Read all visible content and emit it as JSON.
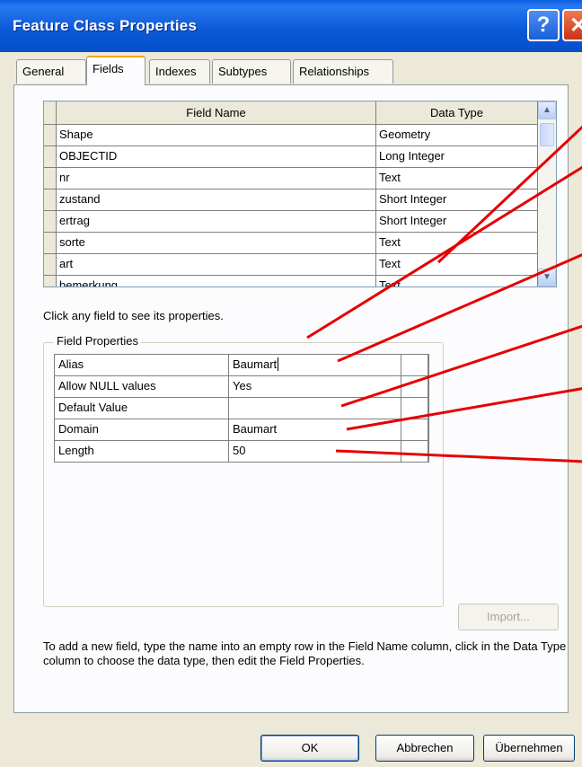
{
  "window": {
    "title": "Feature Class Properties",
    "help_glyph": "?",
    "close_glyph": "✕"
  },
  "tabs": [
    "General",
    "Fields",
    "Indexes",
    "Subtypes",
    "Relationships"
  ],
  "active_tab": "Fields",
  "fields_table": {
    "headers": [
      "Field Name",
      "Data Type"
    ],
    "rows": [
      [
        "Shape",
        "Geometry"
      ],
      [
        "OBJECTID",
        "Long Integer"
      ],
      [
        "nr",
        "Text"
      ],
      [
        "zustand",
        "Short Integer"
      ],
      [
        "ertrag",
        "Short Integer"
      ],
      [
        "sorte",
        "Text"
      ],
      [
        "art",
        "Text"
      ],
      [
        "bemerkung",
        "Text"
      ]
    ],
    "scroll_up_glyph": "▲",
    "scroll_down_glyph": "▼"
  },
  "hint_text": "Click any field to see its properties.",
  "field_properties": {
    "legend": "Field Properties",
    "rows": [
      [
        "Alias",
        "Baumart"
      ],
      [
        "Allow NULL values",
        "Yes"
      ],
      [
        "Default Value",
        ""
      ],
      [
        "Domain",
        "Baumart"
      ],
      [
        "Length",
        "50"
      ]
    ]
  },
  "import_label": "Import...",
  "help_text": "To add a new field, type the name into an empty row in the Field Name column, click in the Data Type column to choose the data type, then edit the Field Properties.",
  "buttons": {
    "ok": "OK",
    "cancel": "Abbrechen",
    "apply": "Übernehmen"
  },
  "colors": {
    "annotation_line": "#e60000",
    "titlebar": "#0a5ee0",
    "dialog_bg": "#ece9d8"
  }
}
